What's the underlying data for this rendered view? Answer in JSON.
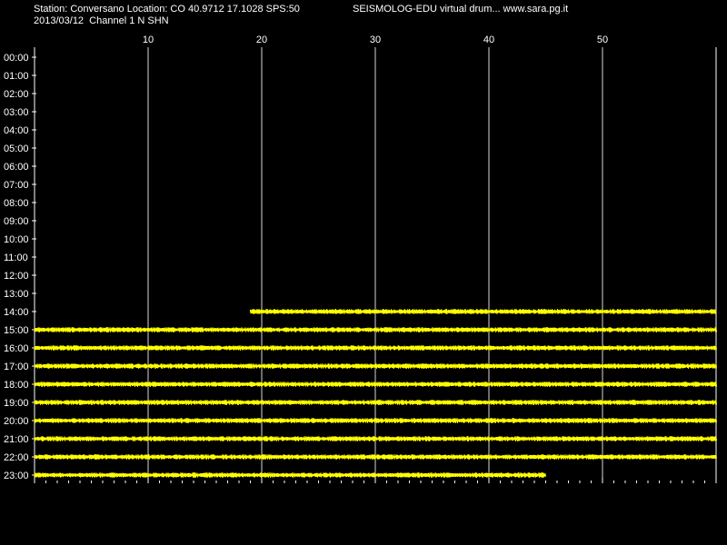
{
  "header": {
    "station_line": "Station: Conversano Location: CO 40.9712 17.1028 SPS:50",
    "date_line": "2013/03/12  Channel 1 N SHN",
    "title": "SEISMOLOG-EDU virtual drum... www.sara.pg.it"
  },
  "colors": {
    "background": "#000000",
    "trace": "#ffff00",
    "grid": "#ffffff",
    "text": "#ffffff"
  },
  "chart_data": {
    "type": "line",
    "title": "SEISMOLOG-EDU virtual drum... www.sara.pg.it",
    "x_unit": "minutes",
    "xlim": [
      0,
      60
    ],
    "x_ticks": [
      10,
      20,
      30,
      40,
      50
    ],
    "x_tick_labels": [
      "10",
      "20",
      "30",
      "40",
      "50"
    ],
    "grid": "vertical lines at x ticks",
    "rows": [
      "00:00",
      "01:00",
      "02:00",
      "03:00",
      "04:00",
      "05:00",
      "06:00",
      "07:00",
      "08:00",
      "09:00",
      "10:00",
      "11:00",
      "12:00",
      "13:00",
      "14:00",
      "15:00",
      "16:00",
      "17:00",
      "18:00",
      "19:00",
      "20:00",
      "21:00",
      "22:00",
      "23:00"
    ],
    "traces": [
      {
        "row": "14:00",
        "start_min": 19,
        "end_min": 60
      },
      {
        "row": "15:00",
        "start_min": 0,
        "end_min": 60
      },
      {
        "row": "16:00",
        "start_min": 0,
        "end_min": 60
      },
      {
        "row": "17:00",
        "start_min": 0,
        "end_min": 60
      },
      {
        "row": "18:00",
        "start_min": 0,
        "end_min": 60
      },
      {
        "row": "19:00",
        "start_min": 0,
        "end_min": 60
      },
      {
        "row": "20:00",
        "start_min": 0,
        "end_min": 60
      },
      {
        "row": "21:00",
        "start_min": 0,
        "end_min": 60
      },
      {
        "row": "22:00",
        "start_min": 0,
        "end_min": 60
      },
      {
        "row": "23:00",
        "start_min": 0,
        "end_min": 45
      }
    ]
  }
}
